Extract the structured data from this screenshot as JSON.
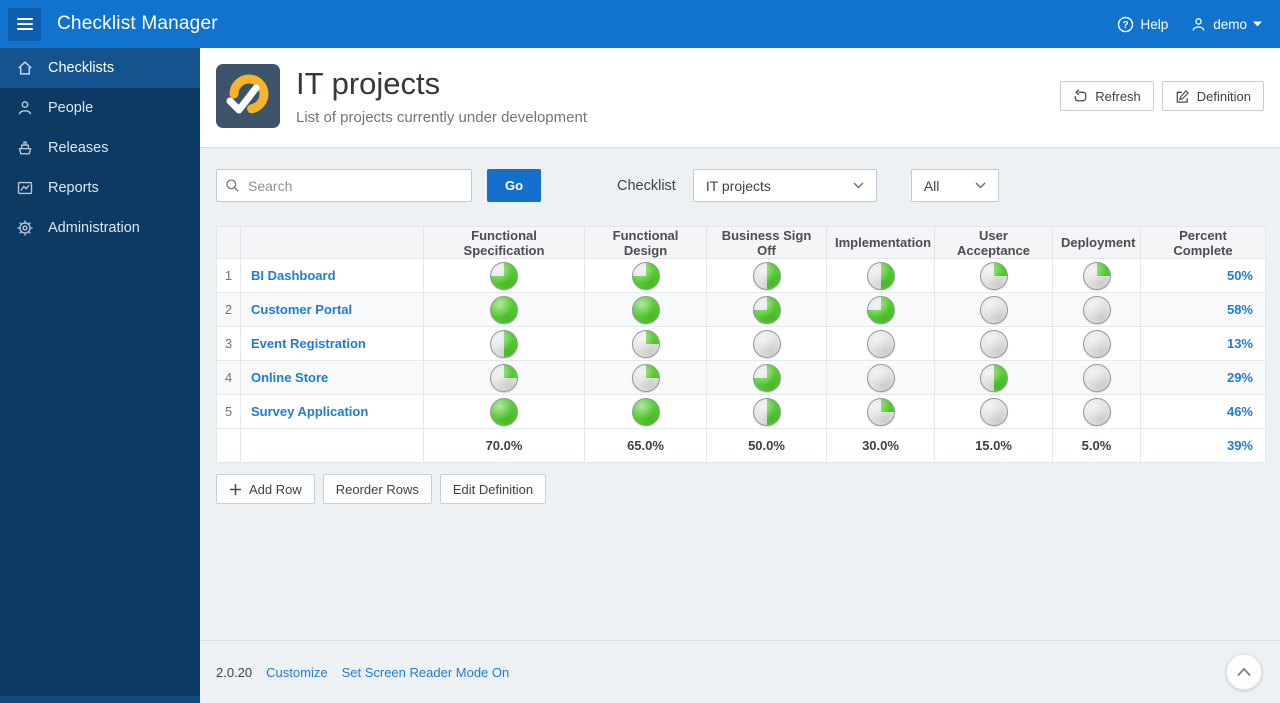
{
  "header": {
    "app_title": "Checklist Manager",
    "help_label": "Help",
    "user_label": "demo",
    "menu_icon": "hamburger-icon",
    "help_icon": "help-circle-icon",
    "user_icon": "person-icon",
    "caret_icon": "caret-down-icon"
  },
  "sidebar": {
    "items": [
      {
        "label": "Checklists",
        "icon": "home-icon",
        "active": true
      },
      {
        "label": "People",
        "icon": "person-icon",
        "active": false
      },
      {
        "label": "Releases",
        "icon": "ship-icon",
        "active": false
      },
      {
        "label": "Reports",
        "icon": "chart-icon",
        "active": false
      },
      {
        "label": "Administration",
        "icon": "gear-icon",
        "active": false
      }
    ]
  },
  "page": {
    "title": "IT projects",
    "subtitle": "List of projects currently under development",
    "icon": "checkmark-badge-icon",
    "actions": {
      "refresh_label": "Refresh",
      "refresh_icon": "refresh-icon",
      "definition_label": "Definition",
      "definition_icon": "edit-icon"
    }
  },
  "filters": {
    "search_placeholder": "Search",
    "search_icon": "search-icon",
    "go_label": "Go",
    "checklist_label": "Checklist",
    "checklist_value": "IT projects",
    "status_value": "All",
    "chevron_icon": "chevron-down-icon"
  },
  "table": {
    "columns": [
      "",
      "",
      "Functional Specification",
      "Functional Design",
      "Business Sign Off",
      "Implementation",
      "User Acceptance",
      "Deployment",
      "Percent Complete"
    ],
    "rows": [
      {
        "num": "1",
        "name": "BI Dashboard",
        "pies": [
          75,
          75,
          50,
          50,
          25,
          25
        ],
        "percent": "50%"
      },
      {
        "num": "2",
        "name": "Customer Portal",
        "pies": [
          100,
          100,
          75,
          75,
          0,
          0
        ],
        "percent": "58%"
      },
      {
        "num": "3",
        "name": "Event Registration",
        "pies": [
          50,
          25,
          0,
          0,
          0,
          0
        ],
        "percent": "13%"
      },
      {
        "num": "4",
        "name": "Online Store",
        "pies": [
          25,
          25,
          75,
          0,
          50,
          0
        ],
        "percent": "29%"
      },
      {
        "num": "5",
        "name": "Survey Application",
        "pies": [
          100,
          100,
          50,
          25,
          0,
          0
        ],
        "percent": "46%"
      }
    ],
    "summary": {
      "values": [
        "70.0%",
        "65.0%",
        "50.0%",
        "30.0%",
        "15.0%",
        "5.0%"
      ],
      "percent": "39%"
    }
  },
  "row_actions": {
    "add_label": "Add Row",
    "add_icon": "plus-icon",
    "reorder_label": "Reorder Rows",
    "edit_label": "Edit Definition"
  },
  "footer": {
    "version": "2.0.20",
    "links": [
      "Customize",
      "Set Screen Reader Mode On"
    ],
    "scroll_top_icon": "chevron-up-icon"
  },
  "colors": {
    "header_bg": "#1173ce",
    "header_btn_bg": "#0d5fae",
    "sidebar_bg": "#0c3a63",
    "sidebar_active_bg": "#15538e",
    "sidebar_strip": "#124a80",
    "body_bg": "#eef1f4",
    "panel_bg": "#ffffff",
    "border": "#d7dce1",
    "accent": "#1470cc",
    "link": "#1f7cd4",
    "text_dark": "#3f4347",
    "pie_fill": "#53cd2d",
    "pie_empty": "#e4e4e4",
    "pie_border": "#94999e",
    "app_tile": "#3d5369",
    "app_arc": "#f7b32c"
  }
}
